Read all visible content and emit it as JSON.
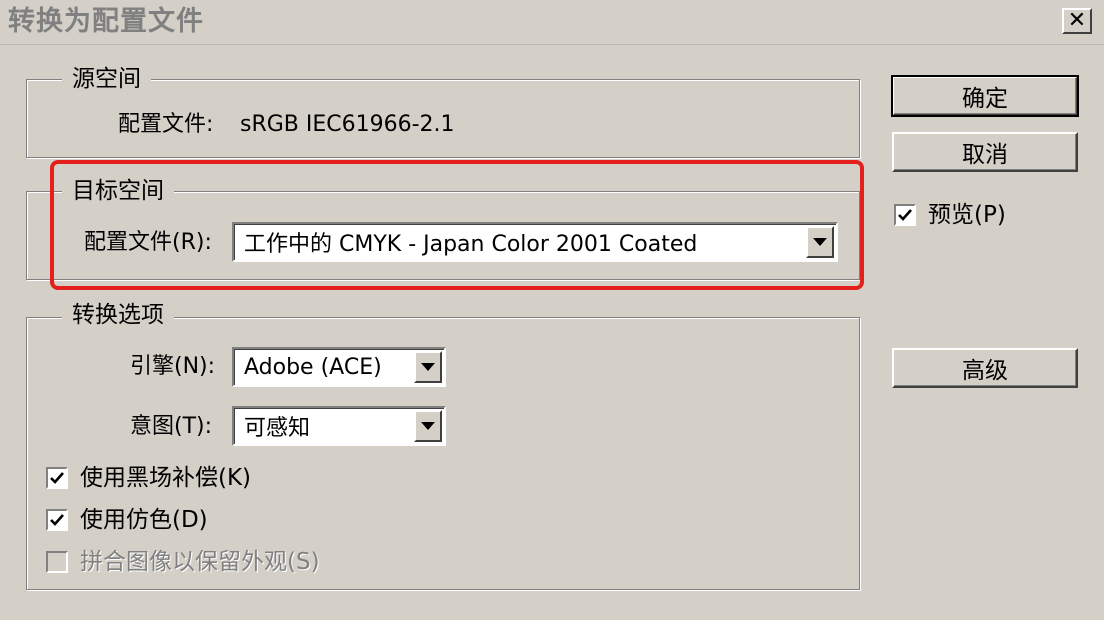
{
  "window": {
    "title": "转换为配置文件"
  },
  "source_space": {
    "legend": "源空间",
    "profile_label": "配置文件:",
    "profile_value": "sRGB IEC61966-2.1"
  },
  "target_space": {
    "legend": "目标空间",
    "profile_label": "配置文件(R):",
    "profile_value": "工作中的 CMYK - Japan Color 2001 Coated"
  },
  "conversion_options": {
    "legend": "转换选项",
    "engine_label": "引擎(N):",
    "engine_value": "Adobe (ACE)",
    "intent_label": "意图(T):",
    "intent_value": "可感知",
    "black_point": {
      "label": "使用黑场补偿(K)",
      "checked": true
    },
    "dither": {
      "label": "使用仿色(D)",
      "checked": true
    },
    "flatten": {
      "label": "拼合图像以保留外观(S)",
      "checked": false,
      "enabled": false
    }
  },
  "buttons": {
    "ok": "确定",
    "cancel": "取消",
    "preview": {
      "label": "预览(P)",
      "checked": true
    },
    "advanced": "高级"
  },
  "colors": {
    "highlight": "#e3201b",
    "dialog_bg": "#d4d0c8"
  },
  "icons": {
    "check": "checkmark-icon",
    "dropdown": "chevron-down-icon",
    "close": "close-icon"
  }
}
